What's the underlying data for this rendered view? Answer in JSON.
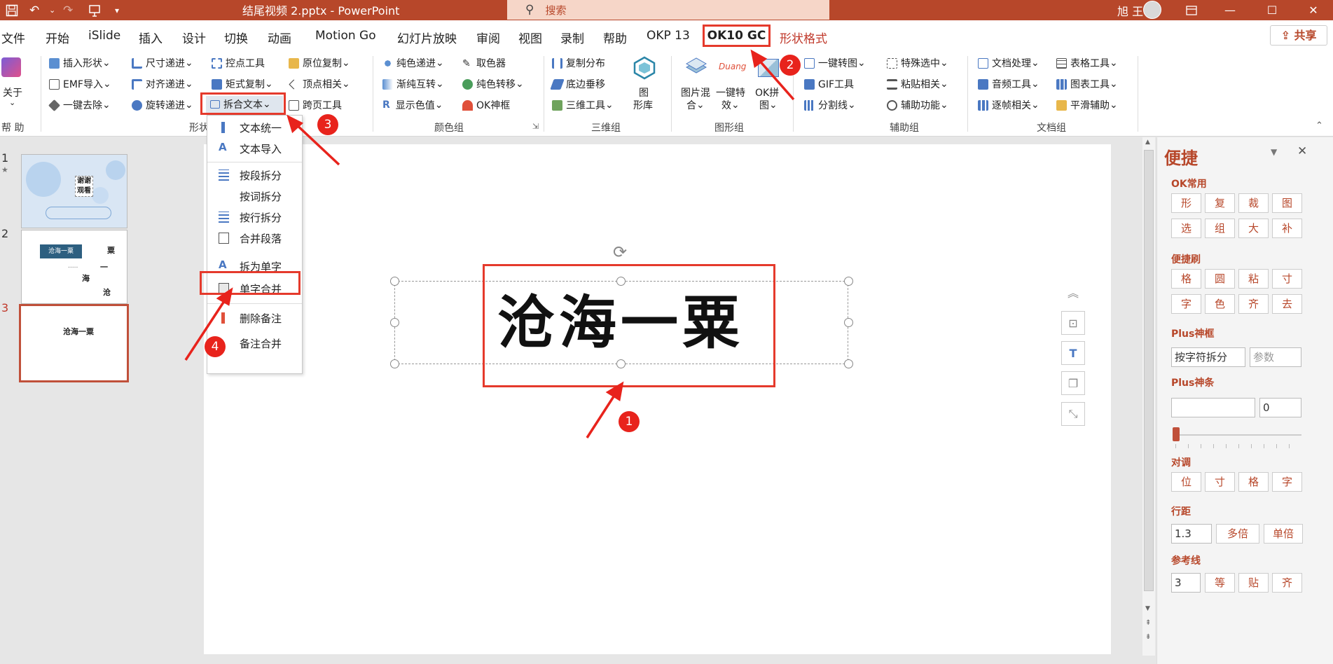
{
  "window": {
    "title": "结尾视频 2.pptx - PowerPoint",
    "search_placeholder": "搜索",
    "user": "旭 王"
  },
  "tabs": [
    "文件",
    "开始",
    "iSlide",
    "插入",
    "设计",
    "切换",
    "动画",
    "Motion Go",
    "幻灯片放映",
    "审阅",
    "视图",
    "录制",
    "帮助",
    "OKP 13",
    "OK10 GC",
    "形状格式"
  ],
  "share": "共享",
  "ribbon": {
    "help": {
      "label1": "关于",
      "group": "帮 助"
    },
    "shape_col1": [
      "插入形状",
      "EMF导入",
      "一键去除"
    ],
    "shape_col2": [
      "尺寸递进",
      "对齐递进",
      "旋转递进"
    ],
    "shape_col3": [
      "控点工具",
      "矩式复制",
      "拆合文本"
    ],
    "shape_col4": [
      "原位复制",
      "顶点相关",
      "跨页工具"
    ],
    "shape_group": "形状",
    "color_col1": [
      "纯色递进",
      "渐纯互转",
      "显示色值"
    ],
    "color_col2": [
      "取色器",
      "纯色转移",
      "OK神框"
    ],
    "color_group": "颜色组",
    "three_col": [
      "复制分布",
      "底边垂移",
      "三维工具"
    ],
    "three_big": [
      "图",
      "形库"
    ],
    "three_group": "三维组",
    "graph_big": [
      [
        "图片混",
        "合"
      ],
      [
        "一键特",
        "效"
      ],
      [
        "OK拼",
        "图"
      ]
    ],
    "duang": "Duang",
    "graph_group": "图形组",
    "aux_col1": [
      "一键转图",
      "GIF工具",
      "分割线"
    ],
    "aux_col2": [
      "特殊选中",
      "粘贴相关",
      "辅助功能"
    ],
    "aux_group": "辅助组",
    "doc_col1": [
      "文档处理",
      "音频工具",
      "逐帧相关"
    ],
    "doc_col2": [
      "表格工具",
      "图表工具",
      "平滑辅助"
    ],
    "doc_group": "文档组"
  },
  "menu": [
    "文本统一",
    "文本导入",
    "按段拆分",
    "按词拆分",
    "按行拆分",
    "合并段落",
    "拆为单字",
    "单字合并",
    "删除备注",
    "备注合并"
  ],
  "slides": [
    {
      "num": "1",
      "star": "★",
      "text": "谢谢观看"
    },
    {
      "num": "2",
      "title": "沧海一粟",
      "chars": [
        "粟",
        "一",
        "海",
        "沧"
      ],
      "dots": "....."
    },
    {
      "num": "3",
      "text": "沧海一粟"
    }
  ],
  "canvas": {
    "text": "沧海一粟"
  },
  "badges": [
    "1",
    "2",
    "3",
    "4"
  ],
  "pane": {
    "title": "便捷",
    "sec1": "OK常用",
    "sec1_btns": [
      "形",
      "复",
      "裁",
      "图",
      "选",
      "组",
      "大",
      "补"
    ],
    "sec2": "便捷刷",
    "sec2_btns": [
      "格",
      "圆",
      "粘",
      "寸",
      "字",
      "色",
      "齐",
      "去"
    ],
    "sec3": "Plus神框",
    "sec3_input": "按字符拆分",
    "sec3_param": "参数",
    "sec4": "Plus神条",
    "sec4_val": "0",
    "sec5": "对调",
    "sec5_btns": [
      "位",
      "寸",
      "格",
      "字"
    ],
    "sec6": "行距",
    "sec6_val": "1.3",
    "sec6_btns": [
      "多倍",
      "单倍"
    ],
    "sec7": "参考线",
    "sec7_val": "3",
    "sec7_btns": [
      "等",
      "贴",
      "齐"
    ]
  },
  "colors": {
    "brand": "#b7472a",
    "highlight": "#e53a2c"
  }
}
